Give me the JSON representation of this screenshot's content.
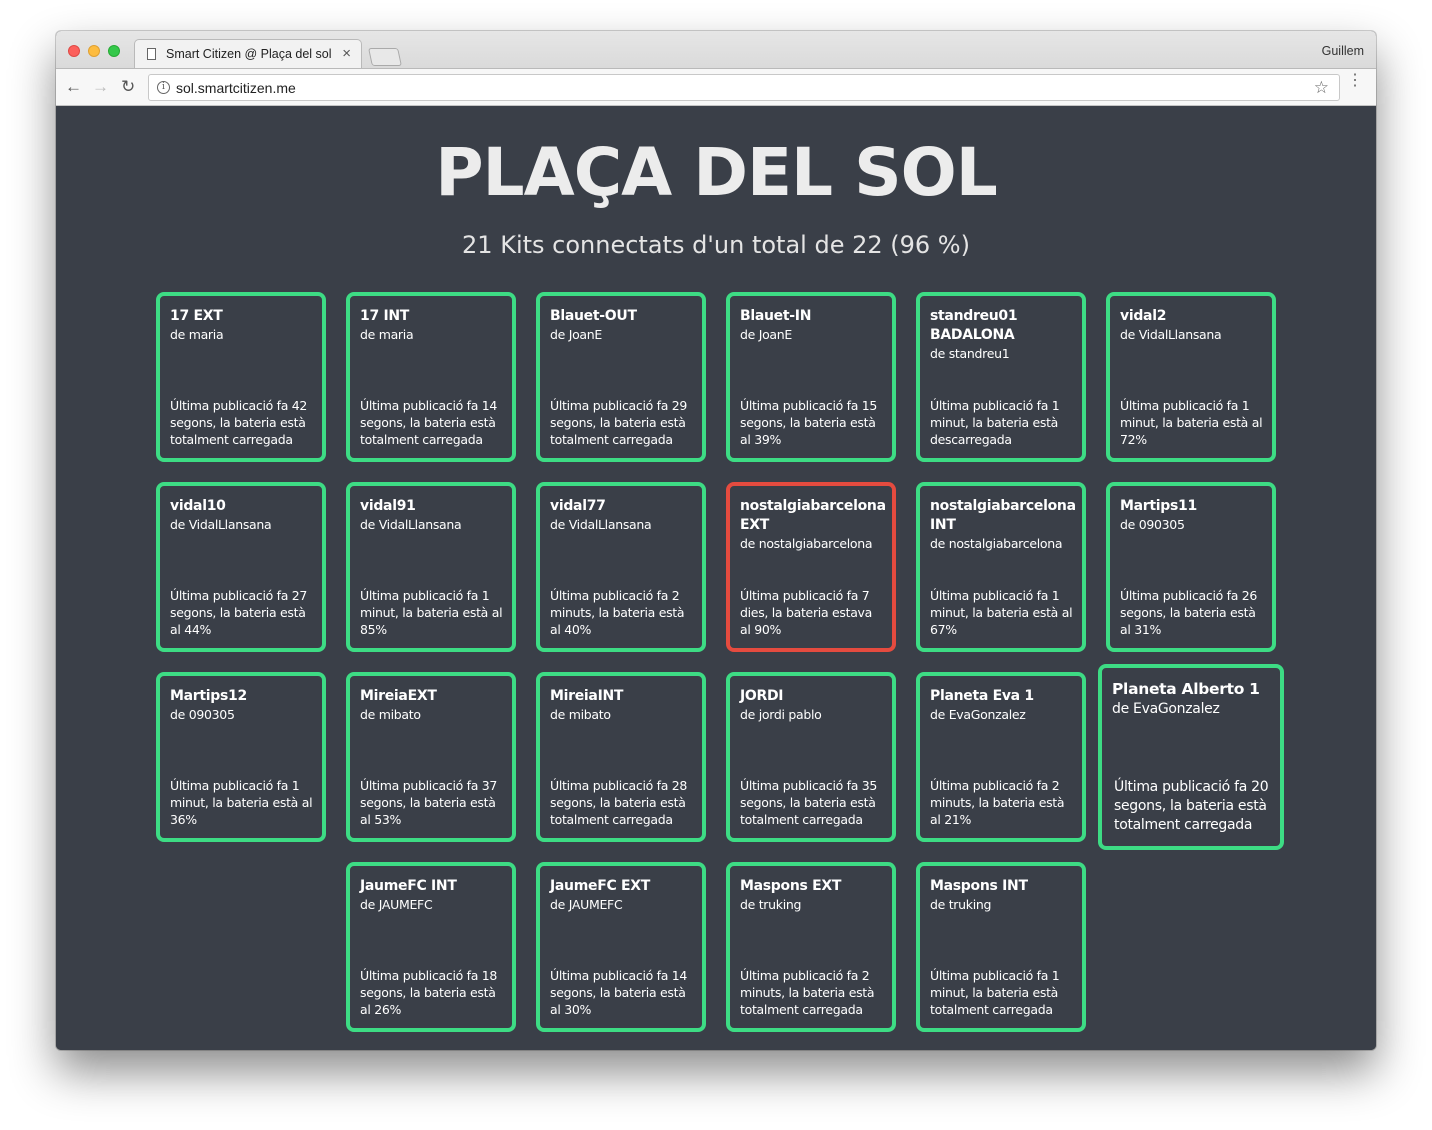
{
  "browser": {
    "tab_title": "Smart Citizen @ Plaça del sol",
    "tab_close": "×",
    "profile_name": "Guillem",
    "url": "sol.smartcitizen.me",
    "back_icon": "←",
    "forward_icon": "→",
    "reload_icon": "↻",
    "info_icon": "i",
    "star_icon": "☆",
    "menu_icon": "⋮"
  },
  "page": {
    "title": "PLAÇA DEL SOL",
    "subtitle": "21 Kits connectats d'un total de 22 (96 %)"
  },
  "colors": {
    "online_border": "#3ddc84",
    "offline_border": "#e54b3f",
    "background": "#3a3f48"
  },
  "kits": [
    {
      "name": "17 EXT",
      "owner": "de maria",
      "status": "Última publicació fa 42 segons, la bateria està totalment carregada",
      "online": true
    },
    {
      "name": "17 INT",
      "owner": "de maria",
      "status": "Última publicació fa 14 segons, la bateria està totalment carregada",
      "online": true
    },
    {
      "name": "Blauet-OUT",
      "owner": "de JoanE",
      "status": "Última publicació fa 29 segons, la bateria està totalment carregada",
      "online": true
    },
    {
      "name": "Blauet-IN",
      "owner": "de JoanE",
      "status": "Última publicació fa 15 segons, la bateria està al 39%",
      "online": true
    },
    {
      "name": "standreu01 BADALONA",
      "owner": "de standreu1",
      "status": "Última publicació fa 1 minut, la bateria està descarregada",
      "online": true
    },
    {
      "name": "vidal2",
      "owner": "de VidalLlansana",
      "status": "Última publicació fa 1 minut, la bateria està al 72%",
      "online": true
    },
    {
      "name": "vidal10",
      "owner": "de VidalLlansana",
      "status": "Última publicació fa 27 segons, la bateria està al 44%",
      "online": true
    },
    {
      "name": "vidal91",
      "owner": "de VidalLlansana",
      "status": "Última publicació fa 1 minut, la bateria està al 85%",
      "online": true
    },
    {
      "name": "vidal77",
      "owner": "de VidalLlansana",
      "status": "Última publicació fa 2 minuts, la bateria està al 40%",
      "online": true
    },
    {
      "name": "nostalgiabarcelona EXT",
      "owner": "de nostalgiabarcelona",
      "status": "Última publicació fa 7 dies, la bateria estava al 90%",
      "online": false
    },
    {
      "name": "nostalgiabarcelona INT",
      "owner": "de nostalgiabarcelona",
      "status": "Última publicació fa 1 minut, la bateria està al 67%",
      "online": true
    },
    {
      "name": "Martips11",
      "owner": "de 090305",
      "status": "Última publicació fa 26 segons, la bateria està al 31%",
      "online": true
    },
    {
      "name": "Martips12",
      "owner": "de 090305",
      "status": "Última publicació fa 1 minut, la bateria està al 36%",
      "online": true
    },
    {
      "name": "MireiaEXT",
      "owner": "de mibato",
      "status": "Última publicació fa 37 segons, la bateria està al 53%",
      "online": true
    },
    {
      "name": "MireiaINT",
      "owner": "de mibato",
      "status": "Última publicació fa 28 segons, la bateria està totalment carregada",
      "online": true
    },
    {
      "name": "JORDI",
      "owner": "de jordi pablo",
      "status": "Última publicació fa 35 segons, la bateria està totalment carregada",
      "online": true
    },
    {
      "name": "Planeta Eva 1",
      "owner": "de EvaGonzalez",
      "status": "Última publicació fa 2 minuts, la bateria està al 21%",
      "online": true
    },
    {
      "name": "Planeta Alberto 1",
      "owner": "de EvaGonzalez",
      "status": "Última publicació fa 20 segons, la bateria està totalment carregada",
      "online": true
    },
    {
      "name": "JaumeFC INT",
      "owner": "de JAUMEFC",
      "status": "Última publicació fa 18 segons, la bateria està al 26%",
      "online": true
    },
    {
      "name": "JaumeFC EXT",
      "owner": "de JAUMEFC",
      "status": "Última publicació fa 14 segons, la bateria està al 30%",
      "online": true
    },
    {
      "name": "Maspons EXT",
      "owner": "de truking",
      "status": "Última publicació fa 2 minuts, la bateria està totalment carregada",
      "online": true
    },
    {
      "name": "Maspons INT",
      "owner": "de truking",
      "status": "Última publicació fa 1 minut, la bateria està totalment carregada",
      "online": true
    }
  ]
}
